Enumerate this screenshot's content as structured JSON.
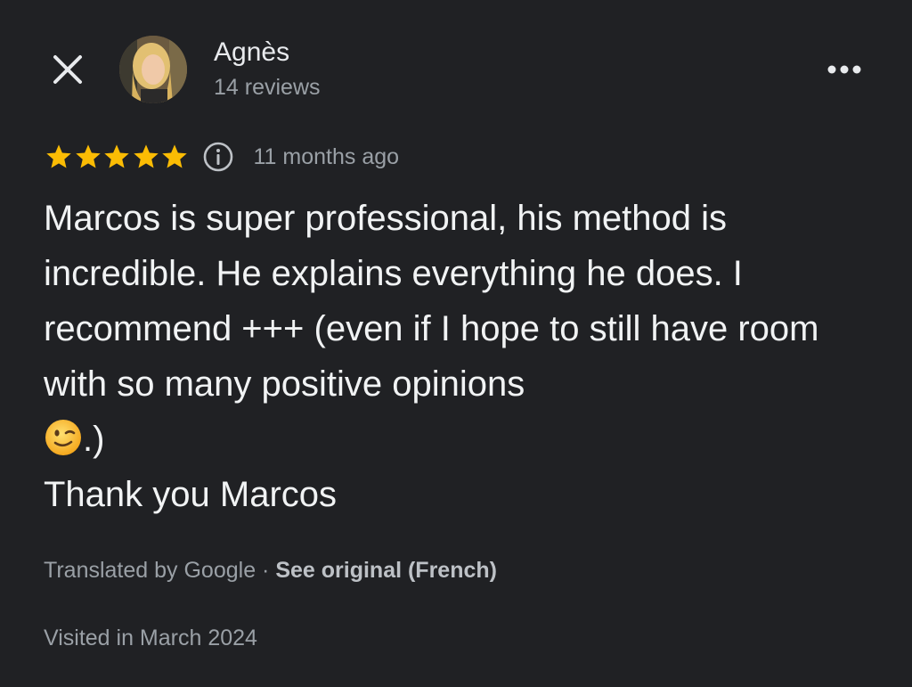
{
  "header": {
    "close_icon": "close-icon",
    "avatar_icon": "profile-photo",
    "author_name": "Agnès",
    "review_count": "14 reviews",
    "more_icon": "more-horizontal-icon"
  },
  "rating": {
    "stars": 5,
    "max_stars": 5,
    "star_color": "#fbbc04",
    "info_icon": "info-icon",
    "time_ago": "11 months ago"
  },
  "review": {
    "text_before_emoji": "Marcos is super professional, his method is incredible. He explains everything he does. I recommend +++ (even if I hope to still have room with so many positive opinions\n",
    "emoji": "winking-face-emoji",
    "text_after_emoji": ".)\nThank you Marcos"
  },
  "translation": {
    "translated_by": "Translated by Google",
    "separator": " · ",
    "see_original": "See original (French)"
  },
  "visited": "Visited in March 2024",
  "colors": {
    "background": "#202124",
    "primary_text": "#e8eaed",
    "secondary_text": "#9aa0a6"
  }
}
